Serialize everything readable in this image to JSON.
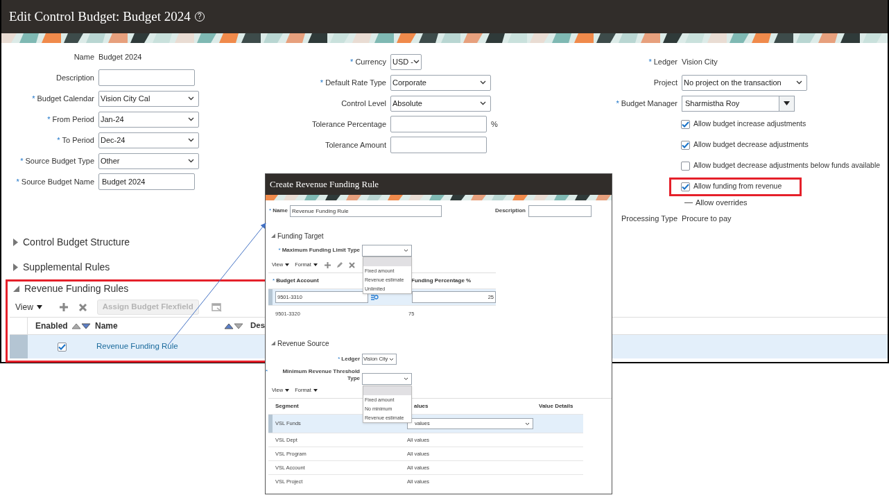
{
  "page": {
    "title": "Edit Control Budget: Budget 2024",
    "help_icon": "?"
  },
  "form_left": [
    {
      "label": "Name",
      "kind": "text",
      "value": "Budget 2024"
    },
    {
      "label": "Description",
      "kind": "input"
    },
    {
      "label": "Budget Calendar",
      "required": "*",
      "kind": "select",
      "value": "Vision City Cal"
    },
    {
      "label": "From Period",
      "required": "*",
      "kind": "select",
      "value": "Jan-24"
    },
    {
      "label": "To Period",
      "required": "*",
      "kind": "select",
      "value": "Dec-24"
    },
    {
      "label": "Source Budget Type",
      "required": "*",
      "kind": "select",
      "value": "Other"
    },
    {
      "label": "Source Budget Name",
      "required": "*",
      "kind": "input",
      "value": "Budget 2024"
    }
  ],
  "form_middle": [
    {
      "label": "Currency",
      "required": "*",
      "kind": "small_select",
      "value": "USD -"
    },
    {
      "label": "Default Rate Type",
      "required": "*",
      "kind": "select",
      "value": "Corporate"
    },
    {
      "label": "Control Level",
      "kind": "select",
      "value": "Absolute"
    },
    {
      "label": "Tolerance Percentage",
      "kind": "input",
      "suffix": "%"
    },
    {
      "label": "Tolerance Amount",
      "kind": "input"
    }
  ],
  "form_right": [
    {
      "label": "Ledger",
      "required": "*",
      "kind": "text",
      "value": "Vision City"
    },
    {
      "label": "Project",
      "kind": "wide_select",
      "value": "No project on the transaction"
    },
    {
      "label": "Budget Manager",
      "required": "*",
      "kind": "lov",
      "value": "Sharmistha Roy"
    }
  ],
  "options": [
    {
      "label": "Allow budget increase adjustments",
      "checked": true,
      "highlighted": false
    },
    {
      "label": "Allow budget decrease adjustments",
      "checked": true,
      "highlighted": false
    },
    {
      "label": "Allow budget decrease adjustments below funds available",
      "checked": false,
      "highlighted": false
    },
    {
      "label": "Allow funding from revenue",
      "checked": true,
      "highlighted": true
    }
  ],
  "allow_overrides": {
    "label": "Allow overrides"
  },
  "processing_type": {
    "label": "Processing Type",
    "value": "Procure to pay"
  },
  "sections": [
    {
      "title": "Control Budget Structure",
      "expanded": false
    },
    {
      "title": "Supplemental Rules",
      "expanded": false
    },
    {
      "title": "Revenue Funding Rules",
      "expanded": true,
      "highlighted": true
    }
  ],
  "rules_table": {
    "view": "View",
    "assign_button": {
      "label": "Assign Budget Flexfield",
      "disabled": true
    },
    "columns": [
      "Enabled",
      "Name",
      "Des"
    ],
    "rows": [
      {
        "enabled": true,
        "name": "Revenue Funding Rule",
        "selected": true
      }
    ]
  },
  "dialog": {
    "title": "Create Revenue Funding Rule",
    "name": {
      "label": "Name",
      "required": "*",
      "value": "Revenue Funding Rule"
    },
    "description": {
      "label": "Description"
    },
    "funding_target": {
      "title": "Funding Target",
      "expanded": true,
      "limit_type": {
        "label": "Maximum Funding Limit Type",
        "required": "*",
        "options": [
          "Fixed amount",
          "Revenue estimate",
          "Unlimited"
        ]
      },
      "toolbar": [
        "View",
        "Format"
      ],
      "columns": [
        {
          "label": "Budget Account",
          "required": "*"
        },
        {
          "label": "Funding Percentage %"
        }
      ],
      "rows": [
        {
          "account": "9501-3310",
          "percentage": "25",
          "selected": true
        },
        {
          "account": "9501-3320",
          "percentage": "75",
          "selected": false
        }
      ]
    },
    "revenue_source": {
      "title": "Revenue Source",
      "expanded": true,
      "ledger": {
        "label": "Ledger",
        "required": "*",
        "value": "Vision City"
      },
      "threshold_type": {
        "label": "Minimum Revenue Threshold Type",
        "required": "*",
        "options": [
          "Fixed amount",
          "No minimum",
          "Revenue estimate"
        ]
      },
      "toolbar": [
        "View",
        "Format"
      ],
      "columns": [
        "Segment",
        "alues",
        "Value Details"
      ],
      "rows": [
        {
          "segment": "VSL Funds",
          "values": "values",
          "selected": true
        },
        {
          "segment": "VSL Dept",
          "values": "All values",
          "selected": false
        },
        {
          "segment": "VSL Program",
          "values": "All values",
          "selected": false
        },
        {
          "segment": "VSL Account",
          "values": "All values",
          "selected": false
        },
        {
          "segment": "VSL Project",
          "values": "All values",
          "selected": false
        }
      ]
    }
  }
}
